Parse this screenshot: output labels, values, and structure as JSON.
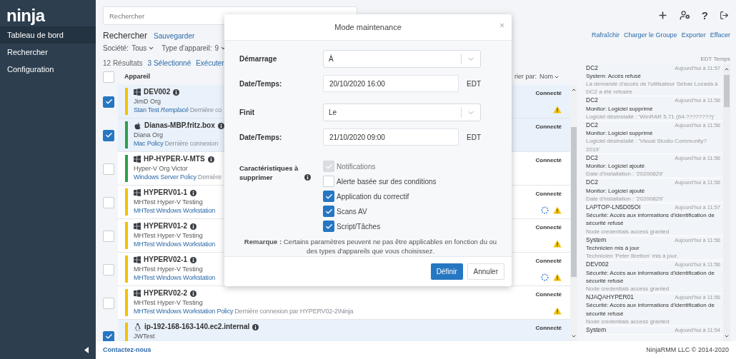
{
  "logo": "ninja",
  "sidebar": {
    "items": [
      {
        "label": "Tableau de bord",
        "selected": true
      },
      {
        "label": "Rechercher",
        "selected": false
      },
      {
        "label": "Configuration",
        "selected": false
      }
    ]
  },
  "search": {
    "placeholder": "Rechercher"
  },
  "help_button": "?",
  "search_header": {
    "title": "Rechercher",
    "save_link": "Sauvegarder"
  },
  "filters": [
    {
      "label": "Société:",
      "value": "Tous"
    },
    {
      "label": "Type d'appareil:",
      "value": "9"
    }
  ],
  "results": {
    "count": "12 Résultats",
    "selected": "3 Sélectionné",
    "action": "Exécuter"
  },
  "sort": {
    "label": "rier par:",
    "value": "Nom"
  },
  "table": {
    "select_all_checked": false,
    "column": "Appareil",
    "rows": [
      {
        "kind": "windows",
        "name": "DEV002",
        "org": "JimD Org",
        "policy": "Stan Test *Remplacé*",
        "last_seen": "Dernière co",
        "status": "Connecté",
        "color": "#f2c200",
        "checked": true,
        "pending": false,
        "warning": true
      },
      {
        "kind": "mac",
        "name": "Dianas-MBP.fritz.box",
        "org": "Diana Org",
        "policy": "Mac Policy",
        "last_seen": "Dernière connexion",
        "status": "Connecté",
        "color": "#2e9e48",
        "checked": true,
        "pending": false,
        "warning": false
      },
      {
        "kind": "windows",
        "name": "HP-HYPER-V-MTS",
        "org": "Hyper-V Org Victor",
        "policy": "Windows Server Policy",
        "last_seen": "Dernière",
        "status": "Connecté",
        "color": "#2e9e48",
        "checked": false,
        "pending": false,
        "warning": false
      },
      {
        "kind": "windows",
        "name": "HYPERV01-1",
        "org": "MHTest Hyper-V Testing",
        "policy": "MHTest Windows Workstation",
        "status": "Connecté",
        "color": "#f2c200",
        "checked": false,
        "pending": true,
        "warning": true
      },
      {
        "kind": "windows",
        "name": "HYPERV01-2",
        "org": "MHTest Hyper-V Testing",
        "policy": "MHTest Windows Workstation",
        "status": "Connecté",
        "color": "#f2c200",
        "checked": false,
        "pending": false,
        "warning": true
      },
      {
        "kind": "windows",
        "name": "HYPERV02-1",
        "org": "MHTest Hyper-V Testing",
        "policy": "MHTest Windows Workstation",
        "status": "Connecté",
        "color": "#f2c200",
        "checked": false,
        "pending": true,
        "warning": true
      },
      {
        "kind": "windows",
        "name": "HYPERV02-2",
        "org": "MHTest Hyper-V Testing",
        "policy": "MHTest Windows Workstation Policy",
        "last_seen": "Dernière connexion par HYPERV02-2\\Ninja",
        "status": "Connecté",
        "color": "#f2c200",
        "checked": false,
        "pending": false,
        "warning": true
      },
      {
        "kind": "linux",
        "name": "ip-192-168-163-140.ec2.internal",
        "org": "JWTest",
        "status": "Connecté",
        "color": "#f2c200",
        "checked": true,
        "pending": false,
        "warning": false
      }
    ]
  },
  "activity": {
    "links": [
      "Rafraîchir",
      "Charger le Groupe",
      "Exporter",
      "Effacer"
    ],
    "time_zone": "EDT Temps",
    "entries": [
      {
        "device": "DC2",
        "time": "Aujourd'hui à 11:57",
        "title": "System: Accès refusé",
        "detail": "La demande d'accès de l'utilisateur Sebas Lozada à DC2 a été refusée"
      },
      {
        "device": "DC2",
        "time": "Aujourd'hui à 11:56",
        "title": "Monitor: Logiciel supprimé",
        "detail": "Logiciel désinstallé : 'WinRAR 5.71 (64-????????)'"
      },
      {
        "device": "DC2",
        "time": "Aujourd'hui à 11:56",
        "title": "Monitor: Logiciel supprimé",
        "detail": "Logiciel désinstallé : 'Visual Studio Community?2019'"
      },
      {
        "device": "DC2",
        "time": "Aujourd'hui à 11:56",
        "title": "Monitor: Logiciel ajouté",
        "detail": "Date d'installation : '20200829'"
      },
      {
        "device": "DC2",
        "time": "Aujourd'hui à 11:56",
        "title": "Monitor: Logiciel ajouté",
        "detail": "Date d'installation : '20200829'"
      },
      {
        "device": "LAPTOP-LN5D05OI",
        "time": "Aujourd'hui à 11:57",
        "title": "Sécurité: Accès aux informations d'identification de sécurité refusé",
        "detail": "Node credentials access granted"
      },
      {
        "device": "System",
        "time": "Aujourd'hui à 11:56",
        "title": "Technicien mis à jour",
        "detail": "Technicien 'Peter Bretton' mis à jour."
      },
      {
        "device": "DEV002",
        "time": "Aujourd'hui à 11:56",
        "title": "Sécurité: Accès aux informations d'identification de sécurité refusé",
        "detail": "Node credentials access granted"
      },
      {
        "device": "NJAQAHYPER01",
        "time": "Aujourd'hui à 11:56",
        "title": "Sécurité: Accès aux informations d'identification de sécurité refusé",
        "detail": "Node credentials access granted"
      },
      {
        "device": "System",
        "time": "Aujourd'hui à 11:54"
      }
    ]
  },
  "modal": {
    "title": "Mode maintenance",
    "close": "×",
    "start": {
      "label": "Démarrage",
      "value": "À"
    },
    "start_datetime": {
      "label": "Date/Temps:",
      "value": "20/10/2020 16:00",
      "zone": "EDT"
    },
    "end": {
      "label": "Finit",
      "value": "Le"
    },
    "end_datetime": {
      "label": "Date/Temps:",
      "value": "21/10/2020 09:00",
      "zone": "EDT"
    },
    "features_label": "Caractéristiques à supprimer",
    "features": [
      {
        "label": "Notifications",
        "checked": true,
        "disabled": true
      },
      {
        "label": "Alerte basée sur des conditions",
        "checked": false,
        "disabled": false
      },
      {
        "label": "Application du correctif",
        "checked": true,
        "disabled": false
      },
      {
        "label": "Scans AV",
        "checked": true,
        "disabled": false
      },
      {
        "label": "Script/Tâches",
        "checked": true,
        "disabled": false
      }
    ],
    "note": "**Remarque :** Certains paramètres peuvent ne pas être applicables en fonction du ou des types d'appareils que vous choisissez.",
    "buttons": [
      {
        "label": "Définir",
        "kind": "primary"
      },
      {
        "label": "Annuler",
        "kind": "secondary"
      }
    ]
  },
  "footer": {
    "contact": "Contactez-nous",
    "copyright": "NinjaRMM LLC © 2014-2020"
  }
}
